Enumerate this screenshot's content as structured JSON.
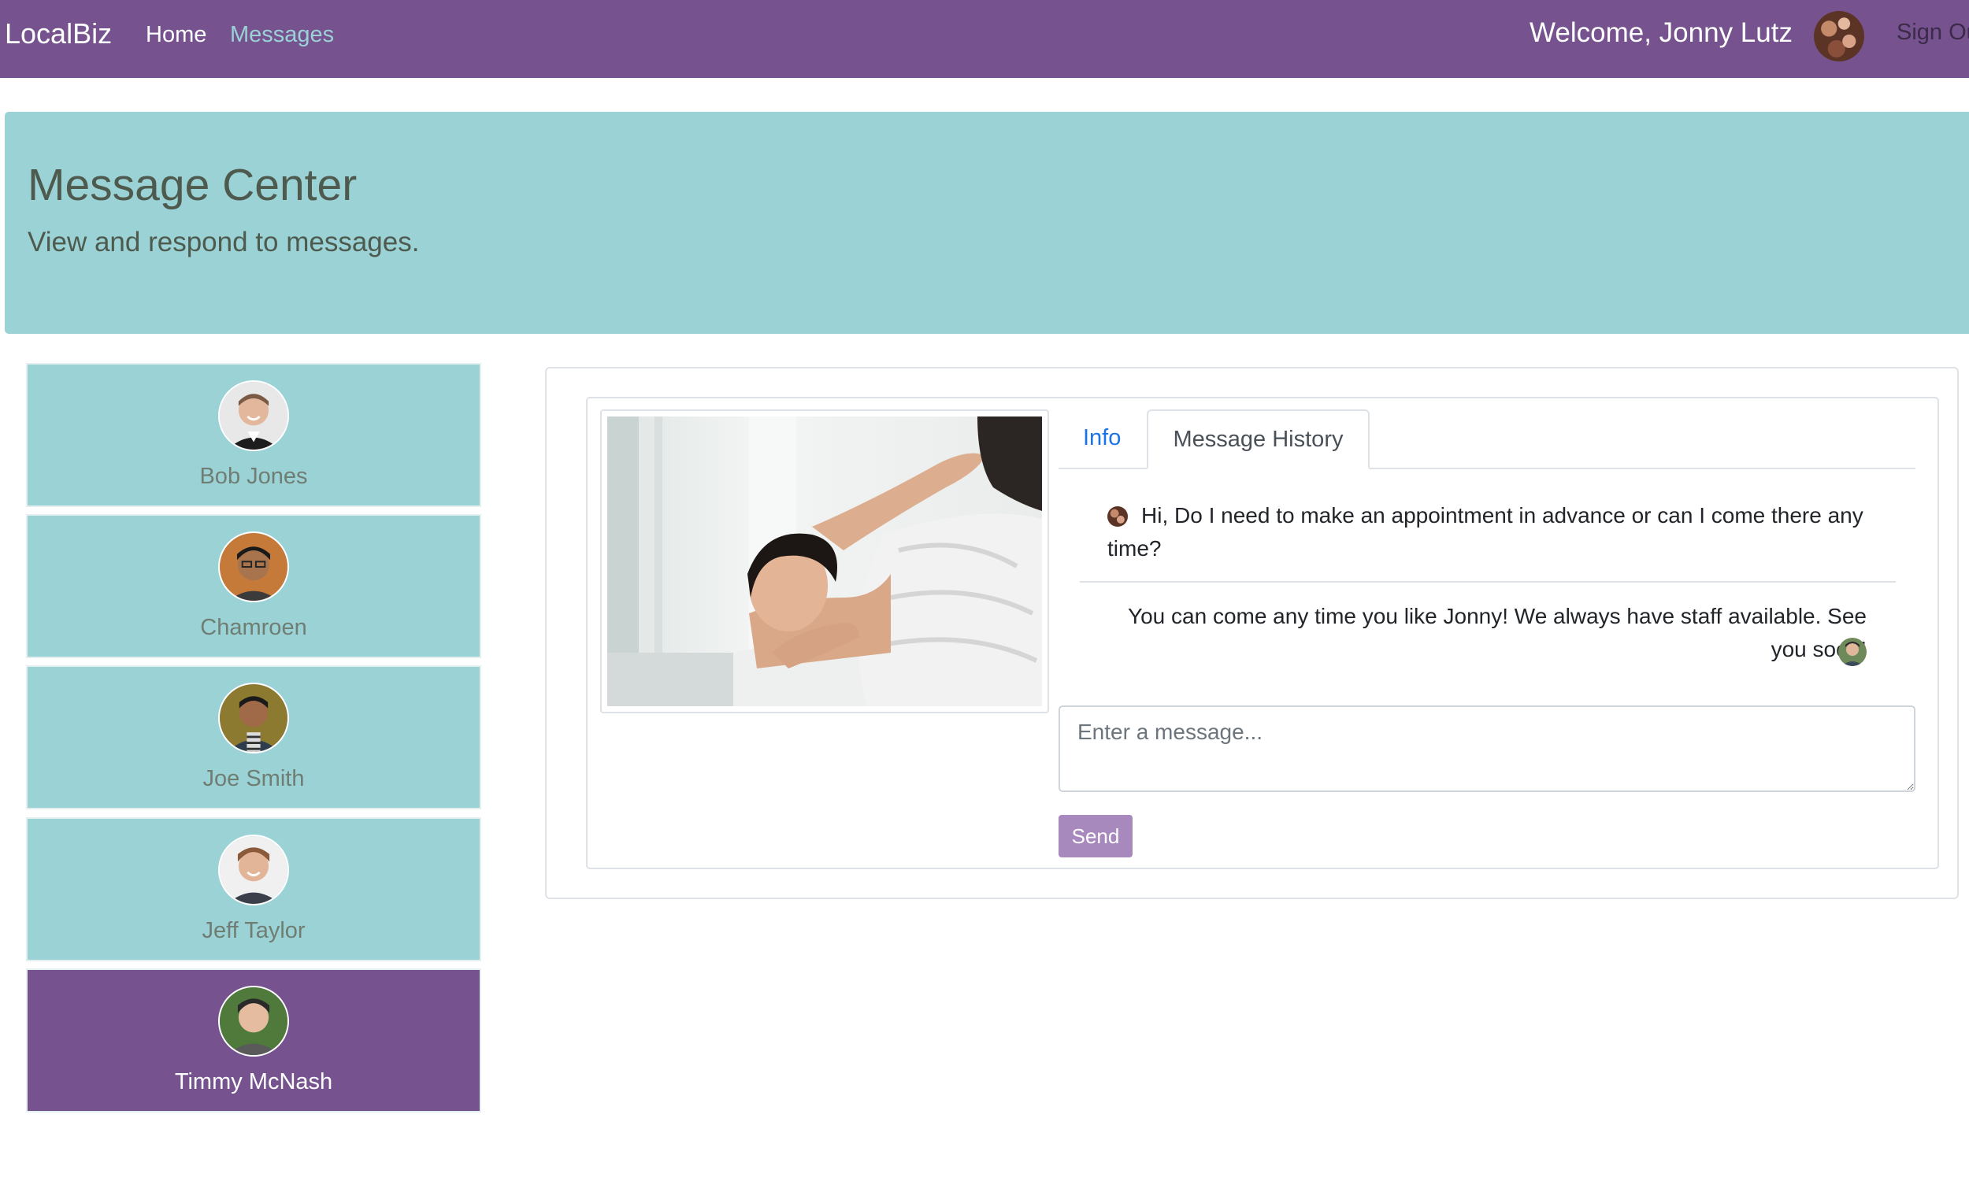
{
  "nav": {
    "brand": "LocalBiz",
    "links": [
      "Home",
      "Messages"
    ],
    "welcome": "Welcome, Jonny Lutz",
    "signout": "Sign Out"
  },
  "header": {
    "title": "Message Center",
    "subtitle": "View and respond to messages."
  },
  "contacts": [
    {
      "name": "Bob Jones",
      "active": false
    },
    {
      "name": "Chamroen",
      "active": false
    },
    {
      "name": "Joe Smith",
      "active": false
    },
    {
      "name": "Jeff Taylor",
      "active": false
    },
    {
      "name": "Timmy McNash",
      "active": true
    }
  ],
  "detail": {
    "tabs": [
      "Info",
      "Message History"
    ],
    "active_tab": "Message History",
    "messages": [
      {
        "from": "user",
        "text": "Hi, Do I need to make an appointment in advance or can I come there any time?"
      },
      {
        "from": "business",
        "text": "You can come any time you like Jonny! We always have staff available. See you soon!"
      }
    ],
    "input_placeholder": "Enter a message...",
    "send_label": "Send"
  },
  "colors": {
    "navbar": "#76528f",
    "teal": "#9bd2d6",
    "send_button": "#a889be",
    "tab_link": "#1a73e8"
  }
}
